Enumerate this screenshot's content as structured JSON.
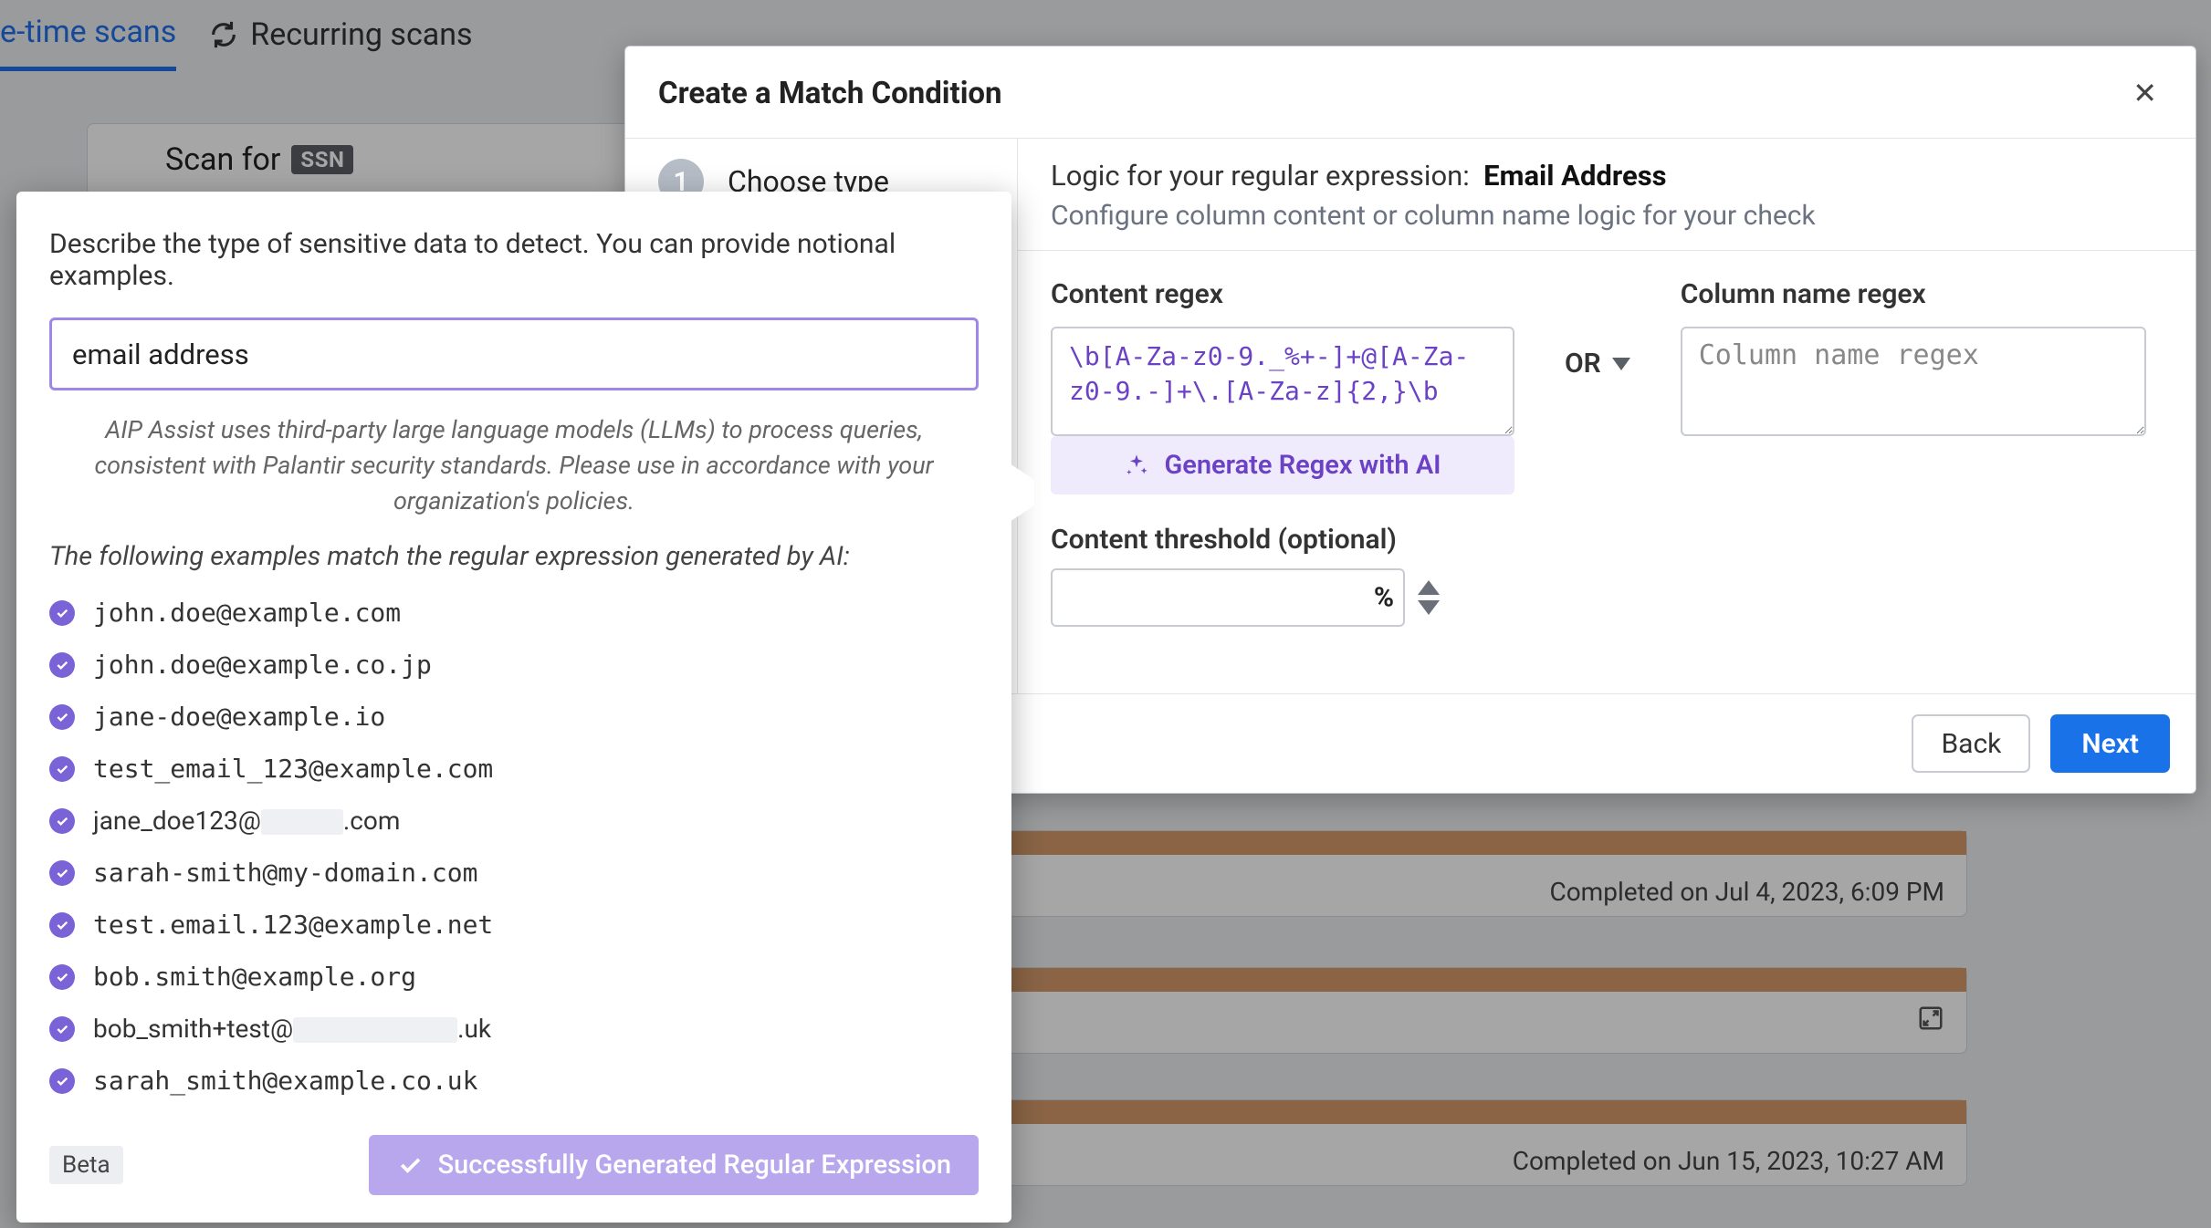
{
  "tabs": {
    "one_time_scans": "e-time scans",
    "recurring_scans": "Recurring scans"
  },
  "scanfor": {
    "label": "Scan for",
    "badge": "SSN"
  },
  "scan_history": {
    "row1": {
      "text": "Completed on Jul 4, 2023, 6:09 PM"
    },
    "row3": {
      "text": "Completed on Jun 15, 2023, 10:27 AM"
    }
  },
  "modal": {
    "title": "Create a Match Condition",
    "step1_num": "1",
    "step1_label": "Choose type",
    "logic_prefix": "Logic for your regular expression:",
    "logic_name": "Email Address",
    "logic_sub": "Configure column content or column name logic for your check",
    "content_regex_label": "Content regex",
    "content_regex_value": "\\b[A-Za-z0-9._%+-]+@[A-Za-z0-9.-]+\\.[A-Za-z]{2,}\\b",
    "or_label": "OR",
    "gen_regex_label": "Generate Regex with AI",
    "col_name_label": "Column name regex",
    "col_name_placeholder": "Column name regex",
    "threshold_label": "Content threshold (optional)",
    "threshold_suffix": "%",
    "threshold_value": "",
    "back": "Back",
    "next": "Next"
  },
  "popover": {
    "desc": "Describe the type of sensitive data to detect. You can provide notional examples.",
    "input_value": "email address",
    "disclaimer": "AIP Assist uses third-party large language models (LLMs) to process queries, consistent with Palantir security standards. Please use in accordance with your organization's policies.",
    "subhead": "The following examples match the regular expression generated by AI:",
    "examples": [
      "john.doe@example.com",
      "john.doe@example.co.jp",
      "jane-doe@example.io",
      "test_email_123@example.com",
      "jane_doe123@",
      ".com",
      "sarah-smith@my-domain.com",
      "test.email.123@example.net",
      "bob.smith@example.org",
      "bob_smith+test@",
      ".uk",
      "sarah_smith@example.co.uk"
    ],
    "beta": "Beta",
    "success": "Successfully Generated Regular Expression"
  }
}
